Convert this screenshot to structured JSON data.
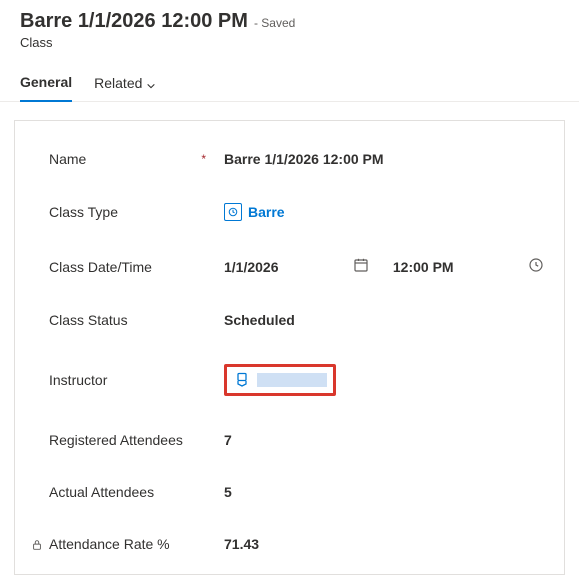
{
  "header": {
    "title": "Barre 1/1/2026 12:00 PM",
    "saved_suffix": "- Saved",
    "entity": "Class"
  },
  "tabs": {
    "general": "General",
    "related": "Related"
  },
  "form": {
    "name": {
      "label": "Name",
      "required_glyph": "*",
      "value": "Barre 1/1/2026 12:00 PM"
    },
    "class_type": {
      "label": "Class Type",
      "value": "Barre"
    },
    "class_datetime": {
      "label": "Class Date/Time",
      "date": "1/1/2026",
      "time": "12:00 PM"
    },
    "class_status": {
      "label": "Class Status",
      "value": "Scheduled"
    },
    "instructor": {
      "label": "Instructor"
    },
    "registered": {
      "label": "Registered Attendees",
      "value": "7"
    },
    "actual": {
      "label": "Actual Attendees",
      "value": "5"
    },
    "rate": {
      "label": "Attendance Rate %",
      "value": "71.43"
    }
  }
}
